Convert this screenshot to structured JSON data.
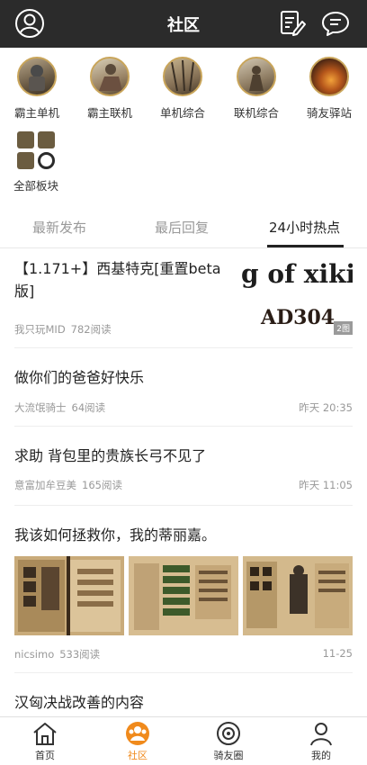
{
  "header": {
    "title": "社区",
    "profile_icon": "user-circle-icon",
    "compose_icon": "edit-icon",
    "message_icon": "chat-bubble-icon"
  },
  "boards": [
    {
      "label": "霸主单机"
    },
    {
      "label": "霸主联机"
    },
    {
      "label": "单机综合"
    },
    {
      "label": "联机综合"
    },
    {
      "label": "骑友驿站"
    },
    {
      "label": "全部板块"
    }
  ],
  "tabs": [
    {
      "label": "最新发布"
    },
    {
      "label": "最后回复"
    },
    {
      "label": "24小时热点",
      "active": true
    }
  ],
  "posts": [
    {
      "title": "【1.171+】西基特克[重置beta版]",
      "author": "我只玩MID",
      "views": "782阅读",
      "date": "",
      "image_text_1": "g of xiki",
      "image_text_2": "AD304",
      "image_count": "2图"
    },
    {
      "title": "做你们的爸爸好快乐",
      "author": "大流氓骑士",
      "views": "64阅读",
      "date": "昨天 20:35"
    },
    {
      "title": "求助 背包里的贵族长弓不见了",
      "author": "意富加牟豆美",
      "views": "165阅读",
      "date": "昨天 11:05"
    },
    {
      "title": "我该如何拯救你，我的蒂丽嘉。",
      "author": "nicsimo",
      "views": "533阅读",
      "date": "11-25"
    },
    {
      "title": "汉匈决战改善的内容",
      "author": "",
      "views": "",
      "date": ""
    }
  ],
  "bottom_nav": [
    {
      "label": "首页",
      "icon": "home-icon"
    },
    {
      "label": "社区",
      "icon": "community-icon",
      "active": true
    },
    {
      "label": "骑友圈",
      "icon": "circle-icon"
    },
    {
      "label": "我的",
      "icon": "person-icon"
    }
  ],
  "colors": {
    "accent": "#f08a1c",
    "topbar": "#2b2b2b",
    "muted": "#999999"
  }
}
